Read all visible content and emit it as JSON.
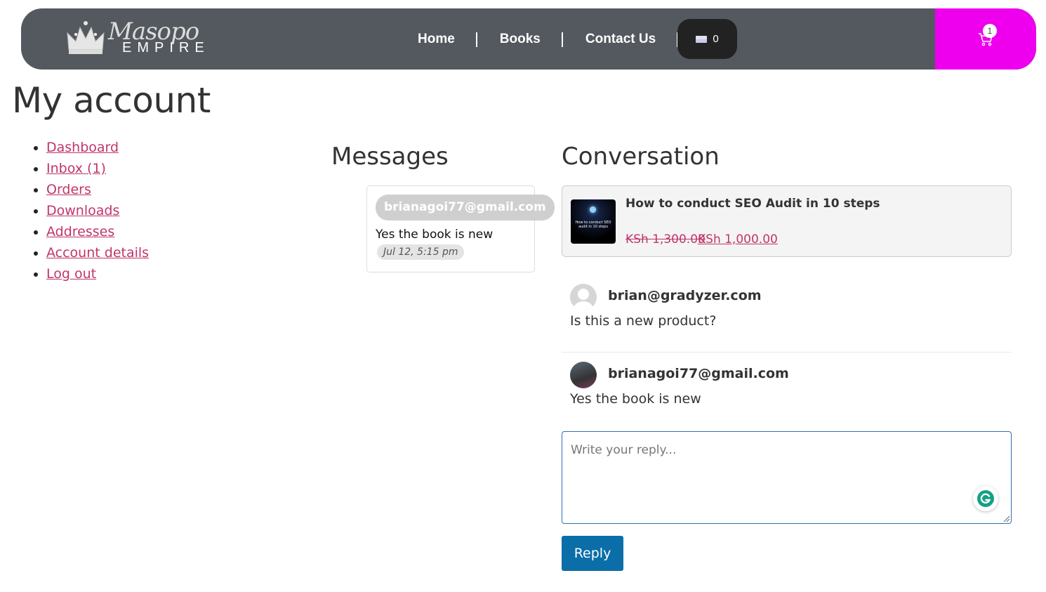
{
  "header": {
    "logo_script": "Masopo",
    "logo_word": "EMPIRE",
    "nav": [
      {
        "label": "Home"
      },
      {
        "label": "Books"
      },
      {
        "label": "Contact Us"
      }
    ],
    "currency_count": "0",
    "cart_count": "1",
    "colors": {
      "header_bg": "#54595f",
      "cart_bg": "#ee00ee"
    }
  },
  "page": {
    "title": "My account"
  },
  "account_nav": [
    {
      "label": "Dashboard"
    },
    {
      "label": "Inbox (1)"
    },
    {
      "label": "Orders"
    },
    {
      "label": "Downloads"
    },
    {
      "label": "Addresses"
    },
    {
      "label": "Account details"
    },
    {
      "label": "Log out"
    }
  ],
  "messages": {
    "heading": "Messages",
    "items": [
      {
        "sender": "brianagoi77@gmail.com",
        "preview": "Yes the book is new",
        "time": "Jul 12, 5:15 pm"
      }
    ]
  },
  "conversation": {
    "heading": "Conversation",
    "product": {
      "title": "How to conduct SEO Audit in 10 steps",
      "thumb_text": "How to conduct SEO audit in 10 steps",
      "price_old": "KSh 1,300.00",
      "price_new": "KSh 1,000.00"
    },
    "entries": [
      {
        "sender": "brian@gradyzer.com",
        "text": "Is this a new product?"
      },
      {
        "sender": "brianagoi77@gmail.com",
        "text": "Yes the book is new"
      }
    ],
    "reply_placeholder": "Write your reply...",
    "reply_button": "Reply"
  }
}
